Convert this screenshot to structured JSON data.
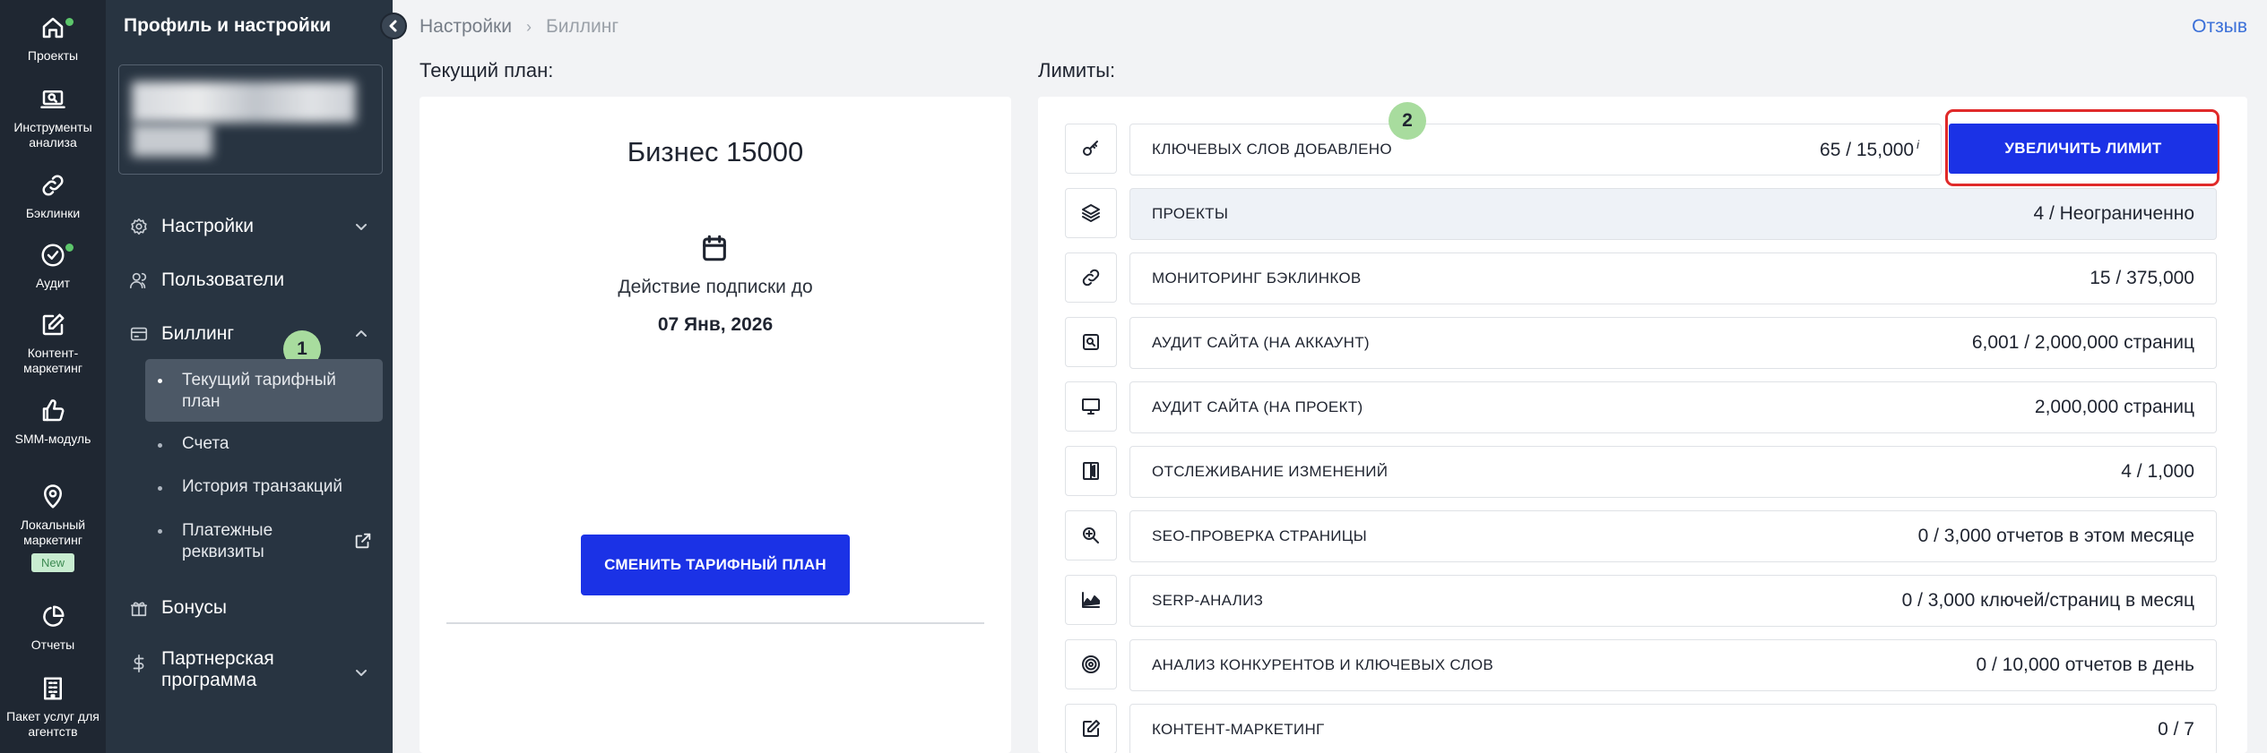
{
  "rail": [
    {
      "label": "Проекты",
      "icon": "home-icon"
    },
    {
      "label": "Инструменты анализа",
      "icon": "laptop-icon"
    },
    {
      "label": "Бэклинки",
      "icon": "link-icon"
    },
    {
      "label": "Аудит",
      "icon": "check-circle-icon"
    },
    {
      "label": "Контент-маркетинг",
      "icon": "edit-icon"
    },
    {
      "label": "SMM-модуль",
      "icon": "thumbs-up-icon"
    },
    {
      "label": "Локальный маркетинг",
      "icon": "map-pin-icon",
      "badge": "New"
    },
    {
      "label": "Отчеты",
      "icon": "pie-chart-icon"
    },
    {
      "label": "Пакет услуг для агентств",
      "icon": "building-icon"
    }
  ],
  "menu": {
    "title": "Профиль и настройки",
    "settings": "Настройки",
    "users": "Пользователи",
    "billing": "Биллинг",
    "billing_sub": [
      "Текущий тарифный план",
      "Счета",
      "История транзакций",
      "Платежные реквизиты"
    ],
    "bonuses": "Бонусы",
    "partner": "Партнерская программа"
  },
  "annotations": {
    "one": "1",
    "two": "2"
  },
  "breadcrumb": {
    "first": "Настройки",
    "sep": "›",
    "second": "Биллинг"
  },
  "feedback": "Отзыв",
  "plan": {
    "section_title": "Текущий план:",
    "name": "Бизнес 15000",
    "until_label": "Действие подписки до",
    "until_date": "07 Янв, 2026",
    "change_button": "СМЕНИТЬ ТАРИФНЫЙ ПЛАН"
  },
  "limits": {
    "section_title": "Лимиты:",
    "increase_button": "УВЕЛИЧИТЬ ЛИМИТ",
    "info_mark": "i",
    "rows": [
      {
        "label": "КЛЮЧЕВЫХ СЛОВ ДОБАВЛЕНО",
        "value": "65 / 15,000",
        "icon": "key-icon"
      },
      {
        "label": "ПРОЕКТЫ",
        "value": "4 / Неограниченно",
        "icon": "layers-icon"
      },
      {
        "label": "МОНИТОРИНГ БЭКЛИНКОВ",
        "value": "15 / 375,000",
        "icon": "link-icon"
      },
      {
        "label": "АУДИТ САЙТА (НА АККАУНТ)",
        "value": "6,001 / 2,000,000 страниц",
        "icon": "search-doc-icon"
      },
      {
        "label": "АУДИТ САЙТА (НА ПРОЕКТ)",
        "value": "2,000,000 страниц",
        "icon": "monitor-icon"
      },
      {
        "label": "ОТСЛЕЖИВАНИЕ ИЗМЕНЕНИЙ",
        "value": "4 / 1,000",
        "icon": "compare-icon"
      },
      {
        "label": "SEO-ПРОВЕРКА СТРАНИЦЫ",
        "value": "0 / 3,000 отчетов в этом месяце",
        "icon": "zoom-in-icon"
      },
      {
        "label": "SERP-АНАЛИЗ",
        "value": "0 / 3,000 ключей/страниц в месяц",
        "icon": "chart-area-icon"
      },
      {
        "label": "АНАЛИЗ КОНКУРЕНТОВ И КЛЮЧЕВЫХ СЛОВ",
        "value": "0 / 10,000 отчетов в день",
        "icon": "target-icon"
      },
      {
        "label": "КОНТЕНТ-МАРКЕТИНГ",
        "value": "0 / 7",
        "icon": "edit-icon"
      }
    ]
  }
}
